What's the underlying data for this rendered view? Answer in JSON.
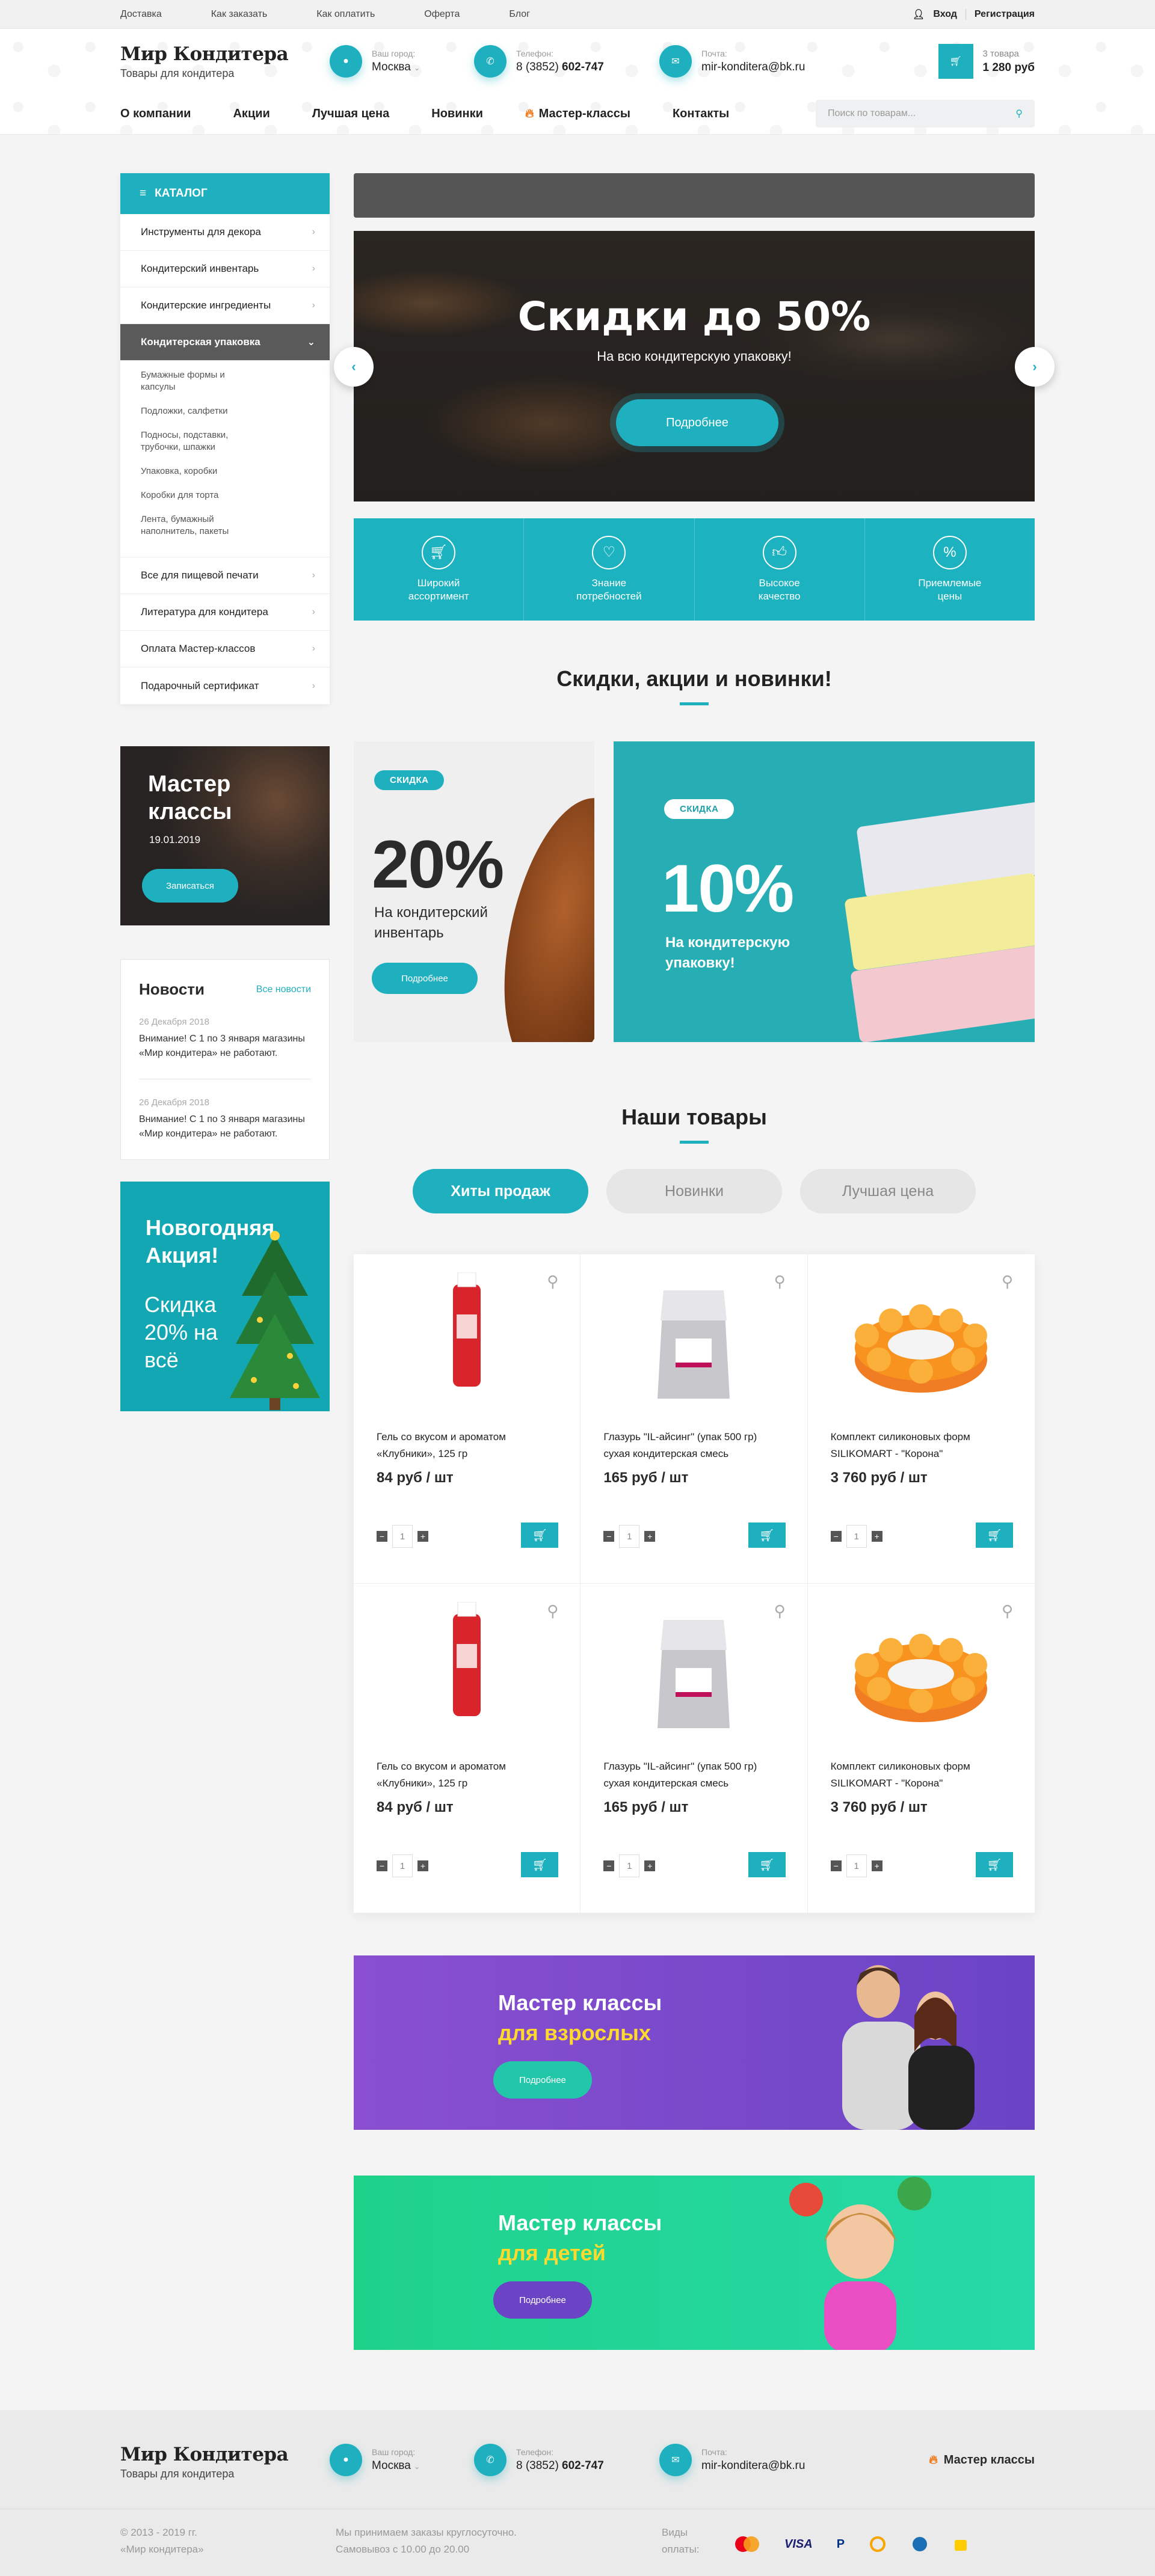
{
  "topbar": {
    "links": [
      "Доставка",
      "Как заказать",
      "Как оплатить",
      "Оферта",
      "Блог"
    ],
    "login": "Вход",
    "register": "Регистрация"
  },
  "header": {
    "logo_title": "Мир Кондитера",
    "logo_sub": "Товары для кондитера",
    "city_label": "Ваш город:",
    "city": "Москва",
    "phone_label": "Телефон:",
    "phone_code": "8 (3852) ",
    "phone_num": "602-747",
    "mail_label": "Почта:",
    "mail": "mir-konditera@bk.ru",
    "cart_count": "3 товара",
    "cart_sum": "1 280 руб"
  },
  "nav": {
    "items": [
      "О компании",
      "Акции",
      "Лучшая цена",
      "Новинки",
      "Мастер-классы",
      "Контакты"
    ],
    "search_placeholder": "Поиск по товарам..."
  },
  "catalog": {
    "title": "Каталог",
    "items_top": [
      "Инструменты для декора",
      "Кондитерский инвентарь",
      "Кондитерские ингредиенты"
    ],
    "active": "Кондитерская упаковка",
    "subs": [
      "Бумажные формы и капсулы",
      "Подложки, салфетки",
      "Подносы, подставки, трубочки, шпажки",
      "Упаковка, коробки",
      "Коробки для торта",
      "Лента, бумажный наполнитель, пакеты"
    ],
    "items_bottom": [
      "Все для пищевой печати",
      "Литература для кондитера",
      "Оплата Мастер-классов",
      "Подарочный сертификат"
    ]
  },
  "masterclass_card": {
    "title": "Мастер классы",
    "date": "19.01.2019",
    "button": "Записаться"
  },
  "news": {
    "title": "Новости",
    "all": "Все новости",
    "items": [
      {
        "date": "26 Декабря 2018",
        "text": "Внимание! С 1 по 3 января магазины «Мир кондитера» не работают."
      },
      {
        "date": "26 Декабря 2018",
        "text": "Внимание! С 1 по 3 января магазины «Мир кондитера» не работают."
      }
    ]
  },
  "promo": {
    "title": "Новогодняя Акция!",
    "text": "Скидка 20% на всё"
  },
  "slider": {
    "title": "Скидки до 50%",
    "subtitle": "На всю кондитерскую упаковку!",
    "button": "Подробнее"
  },
  "features": [
    "Широкий ассортимент",
    "Знание потребностей",
    "Высокое качество",
    "Приемлемые цены"
  ],
  "section1": {
    "title": "Скидки, акции и новинки!"
  },
  "banner1": {
    "tag": "СКИДКА",
    "pct": "20%",
    "text": "На кондитерский инвентарь",
    "button": "Подробнее"
  },
  "banner2": {
    "tag": "СКИДКА",
    "pct": "10%",
    "text": "На кондитерскую упаковку!"
  },
  "section2": {
    "title": "Наши товары",
    "tabs": [
      "Хиты продаж",
      "Новинки",
      "Лучшая цена"
    ]
  },
  "products": [
    {
      "name": "Гель со вкусом и ароматом «Клубники», 125 гр",
      "price": "84 руб / шт",
      "qty": "1"
    },
    {
      "name": "Глазурь \"IL-айсинг\" (упак 500 гр) сухая кондитерская смесь",
      "price": "165 руб / шт",
      "qty": "1"
    },
    {
      "name": "Комплект силиконовых форм SILIKOMART - \"Корона\"",
      "price": "3 760 руб / шт",
      "qty": "1"
    },
    {
      "name": "Гель со вкусом и ароматом «Клубники», 125 гр",
      "price": "84 руб / шт",
      "qty": "1"
    },
    {
      "name": "Глазурь \"IL-айсинг\" (упак 500 гр) сухая кондитерская смесь",
      "price": "165 руб / шт",
      "qty": "1"
    },
    {
      "name": "Комплект силиконовых форм SILIKOMART - \"Корона\"",
      "price": "3 760 руб / шт",
      "qty": "1"
    }
  ],
  "mc_adults": {
    "t1": "Мастер классы",
    "t2": "для взрослых",
    "button": "Подробнее"
  },
  "mc_kids": {
    "t1": "Мастер классы",
    "t2": "для детей",
    "button": "Подробнее"
  },
  "footer": {
    "logo_title": "Мир Кондитера",
    "logo_sub": "Товары для кондитера",
    "city_label": "Ваш город:",
    "city": "Москва",
    "phone_label": "Телефон:",
    "phone_code": "8 (3852) ",
    "phone_num": "602-747",
    "mail_label": "Почта:",
    "mail": "mir-konditera@bk.ru",
    "mk": "Мастер классы",
    "copy1": "© 2013 - 2019 гг.",
    "copy2": "«Мир кондитера»",
    "hours1": "Мы принимаем заказы круглосуточно.",
    "hours2": "Самовывоз с 10.00 до 20.00",
    "pay_label1": "Виды",
    "pay_label2": "оплаты:",
    "visa": "VISA"
  }
}
